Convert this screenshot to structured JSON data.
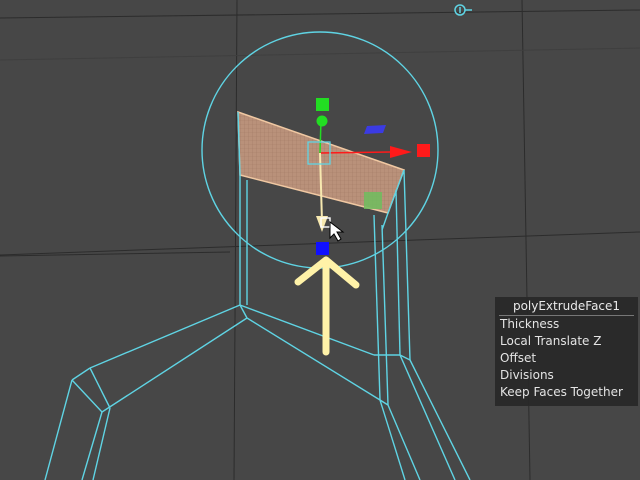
{
  "channel_box": {
    "node_name": "polyExtrudeFace1",
    "attributes": [
      {
        "label": "Thickness"
      },
      {
        "label": "Local Translate Z"
      },
      {
        "label": "Offset"
      },
      {
        "label": "Divisions"
      },
      {
        "label": "Keep Faces Together"
      }
    ]
  },
  "colors": {
    "viewport_bg": "#474747",
    "grid": "#2e2e2e",
    "wireframe": "#5fd4e4",
    "selected_face": "#c9a07a",
    "axis_x": "#ff1a1a",
    "axis_y": "#22dd22",
    "axis_z": "#1010ff",
    "annotation_arrow": "#fff2a8"
  },
  "icons": {
    "camera_pivot": "camera-pivot-icon",
    "cursor": "mouse-cursor-icon",
    "annotation": "arrow-up-icon"
  }
}
